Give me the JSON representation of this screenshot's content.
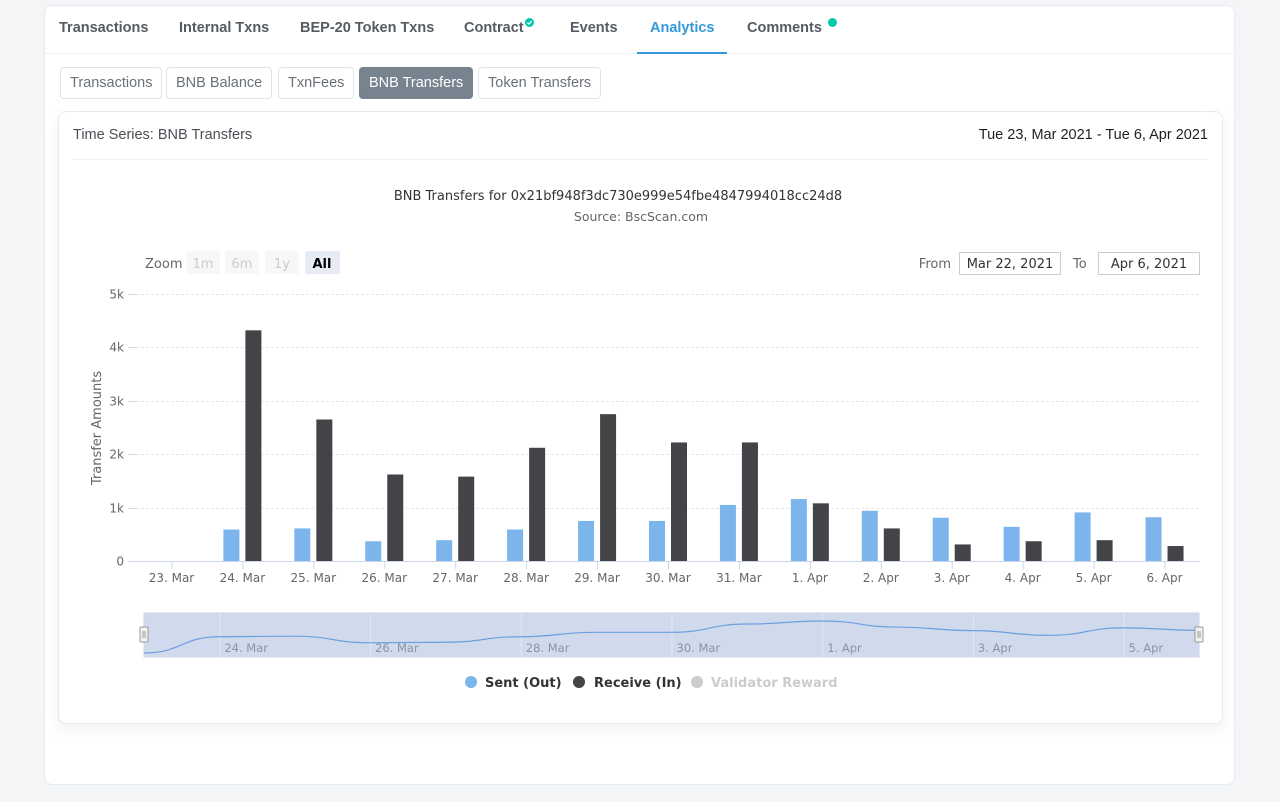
{
  "tabs": [
    {
      "label": "Transactions",
      "active": false
    },
    {
      "label": "Internal Txns",
      "active": false
    },
    {
      "label": "BEP-20 Token Txns",
      "active": false
    },
    {
      "label": "Contract",
      "active": false,
      "badge": "verified-check"
    },
    {
      "label": "Events",
      "active": false
    },
    {
      "label": "Analytics",
      "active": true
    },
    {
      "label": "Comments",
      "active": false,
      "badge": "dot"
    }
  ],
  "subtabs": [
    {
      "label": "Transactions",
      "active": false
    },
    {
      "label": "BNB Balance",
      "active": false
    },
    {
      "label": "TxnFees",
      "active": false
    },
    {
      "label": "BNB Transfers",
      "active": true
    },
    {
      "label": "Token Transfers",
      "active": false
    }
  ],
  "panel": {
    "title": "Time Series: BNB Transfers",
    "date_range": "Tue 23, Mar 2021 - Tue 6, Apr 2021"
  },
  "range_selector": {
    "zoom_label": "Zoom",
    "buttons": [
      {
        "label": "1m",
        "enabled": false,
        "active": false
      },
      {
        "label": "6m",
        "enabled": false,
        "active": false
      },
      {
        "label": "1y",
        "enabled": false,
        "active": false
      },
      {
        "label": "All",
        "enabled": true,
        "active": true
      }
    ],
    "from_label": "From",
    "from_value": "Mar 22, 2021",
    "to_label": "To",
    "to_value": "Apr 6, 2021"
  },
  "colors": {
    "sent": "#7cb5ec",
    "receive": "#434348",
    "validator": "#cccccc",
    "accent": "#3498db",
    "badge": "#00c9a7"
  },
  "chart_data": {
    "type": "bar",
    "title": "BNB Transfers for 0x21bf948f3dc730e999e54fbe4847994018cc24d8",
    "subtitle": "Source: BscScan.com",
    "xlabel": "",
    "ylabel": "Transfer Amounts",
    "ylim": [
      0,
      5000
    ],
    "yticks": [
      0,
      1000,
      2000,
      3000,
      4000,
      5000
    ],
    "ytick_labels": [
      "0",
      "1k",
      "2k",
      "3k",
      "4k",
      "5k"
    ],
    "grid": true,
    "legend": "bottom-center",
    "categories": [
      "23. Mar",
      "24. Mar",
      "25. Mar",
      "26. Mar",
      "27. Mar",
      "28. Mar",
      "29. Mar",
      "30. Mar",
      "31. Mar",
      "1. Apr",
      "2. Apr",
      "3. Apr",
      "4. Apr",
      "5. Apr",
      "6. Apr"
    ],
    "series": [
      {
        "name": "Sent (Out)",
        "visible": true,
        "values": [
          0,
          590,
          610,
          370,
          390,
          590,
          750,
          750,
          1050,
          1160,
          940,
          810,
          640,
          910,
          820
        ]
      },
      {
        "name": "Receive (In)",
        "visible": true,
        "values": [
          0,
          4320,
          2650,
          1620,
          1580,
          2120,
          2750,
          2220,
          2220,
          1080,
          610,
          310,
          370,
          390,
          280
        ]
      },
      {
        "name": "Validator Reward",
        "visible": false,
        "values": []
      }
    ],
    "navigator": {
      "series": "Sent (Out)",
      "labels": [
        "24. Mar",
        "26. Mar",
        "28. Mar",
        "30. Mar",
        "1. Apr",
        "3. Apr",
        "5. Apr"
      ]
    }
  }
}
